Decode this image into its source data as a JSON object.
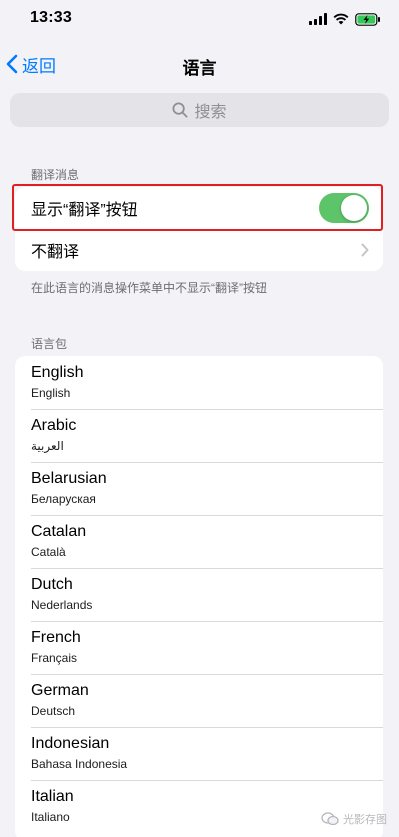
{
  "status_bar": {
    "time": "13:33"
  },
  "nav": {
    "back_label": "返回",
    "title": "语言"
  },
  "search": {
    "placeholder": "搜索"
  },
  "translate_section": {
    "header": "翻译消息",
    "show_button_label": "显示“翻译”按钮",
    "show_button_on": true,
    "no_translate_label": "不翻译",
    "footer": "在此语言的消息操作菜单中不显示“翻译”按钮"
  },
  "language_section": {
    "header": "语言包",
    "items": [
      {
        "name": "English",
        "native": "English"
      },
      {
        "name": "Arabic",
        "native": "العربية"
      },
      {
        "name": "Belarusian",
        "native": "Беларуская"
      },
      {
        "name": "Catalan",
        "native": "Català"
      },
      {
        "name": "Dutch",
        "native": "Nederlands"
      },
      {
        "name": "French",
        "native": "Français"
      },
      {
        "name": "German",
        "native": "Deutsch"
      },
      {
        "name": "Indonesian",
        "native": "Bahasa Indonesia"
      },
      {
        "name": "Italian",
        "native": "Italiano"
      }
    ]
  },
  "watermark": {
    "text": "光影存图"
  },
  "colors": {
    "accent": "#007aff",
    "toggle_on": "#5ec46a",
    "highlight": "#e02020"
  }
}
